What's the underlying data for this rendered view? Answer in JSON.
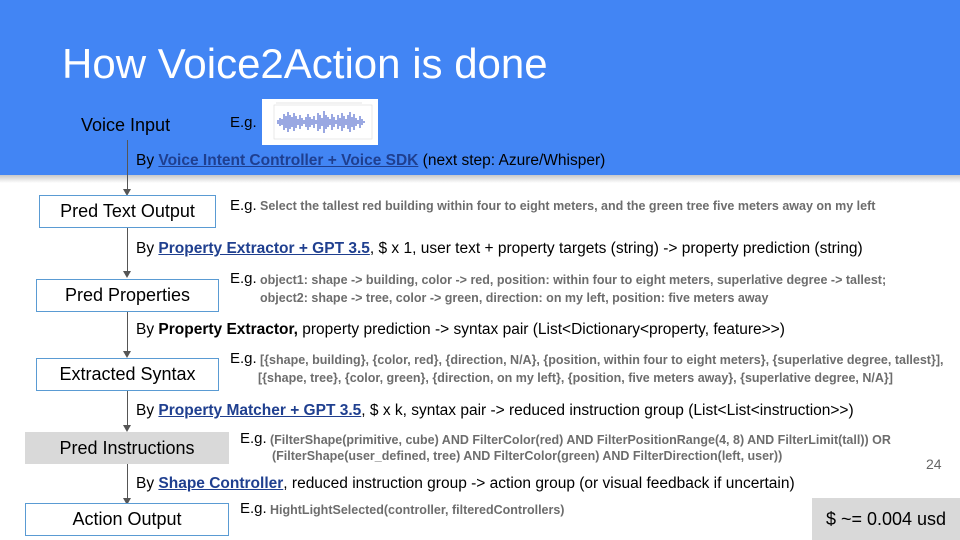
{
  "slide": {
    "title": "How Voice2Action is done",
    "page_number": "24",
    "cost": "$ ~= 0.004 usd"
  },
  "voice_input": {
    "label": "Voice Input",
    "eg": "E.g.",
    "image_icon": "audio-waveform-image"
  },
  "steps": [
    {
      "pre": "By ",
      "link": "Voice Intent Controller + Voice SDK",
      "post": " (next step: Azure/Whisper)"
    },
    {
      "pre": "By ",
      "link": "Property Extractor + GPT 3.5",
      "post": ", $ x 1, user text + property targets (string) -> property prediction (string)"
    },
    {
      "pre": "By ",
      "bold": "Property Extractor,",
      "post": " property prediction -> syntax pair (List<Dictionary<property, feature>>)"
    },
    {
      "pre": "By ",
      "link": "Property Matcher + GPT 3.5",
      "post": ", $ x k, syntax pair -> reduced instruction group (List<List<instruction>>)"
    },
    {
      "pre": "By ",
      "link": "Shape Controller",
      "post": ", reduced instruction group -> action group (or visual feedback if uncertain)"
    }
  ],
  "boxes": [
    {
      "label": "Pred Text Output"
    },
    {
      "label": "Pred Properties"
    },
    {
      "label": "Extracted Syntax"
    },
    {
      "label": "Pred Instructions"
    },
    {
      "label": "Action Output"
    }
  ],
  "examples": {
    "eg": "E.g.",
    "text_output": "Select the tallest red building within four to eight meters, and the green tree five meters away on my left",
    "properties_1": "object1: shape -> building, color -> red, position: within four to eight meters, superlative degree -> tallest;",
    "properties_2": "object2: shape -> tree, color -> green, direction: on my left, position: five meters away",
    "syntax_1": "[{shape, building}, {color, red}, {direction, N/A}, {position, within four to eight meters}, {superlative degree, tallest}],",
    "syntax_2": "[{shape, tree}, {color, green}, {direction, on my left}, {position, five meters away}, {superlative degree, N/A}]",
    "instructions_1": "(FilterShape(primitive, cube) AND FilterColor(red) AND FilterPositionRange(4, 8) AND FilterLimit(tall)) OR",
    "instructions_2": "(FilterShape(user_defined, tree) AND FilterColor(green) AND FilterDirection(left, user))",
    "action": "HightLightSelected(controller, filteredControllers)"
  },
  "colors": {
    "header": "#4285f4",
    "link": "#1f3f8f",
    "box_border": "#5a9bd3",
    "example_text": "#6d6d6d",
    "gray_fill": "#d9d9d9"
  }
}
